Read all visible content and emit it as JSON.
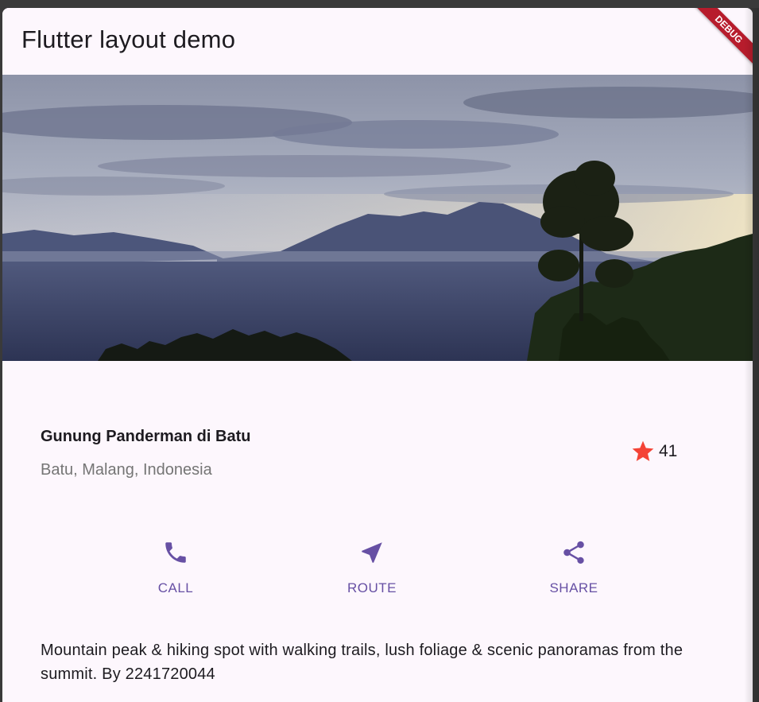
{
  "appbar": {
    "title": "Flutter layout demo",
    "debug_banner": "DEBUG"
  },
  "hero": {
    "image": "mountain-landscape-photo"
  },
  "place": {
    "name": "Gunung Panderman di Batu",
    "location": "Batu, Malang, Indonesia",
    "favorite_count": "41",
    "star_color": "#f44336"
  },
  "actions": [
    {
      "label": "CALL",
      "icon": "phone-icon"
    },
    {
      "label": "ROUTE",
      "icon": "navigation-icon"
    },
    {
      "label": "SHARE",
      "icon": "share-icon"
    }
  ],
  "accent_color": "#6750a4",
  "description": "Mountain peak & hiking spot with walking trails, lush foliage & scenic panoramas from the summit. By 2241720044"
}
